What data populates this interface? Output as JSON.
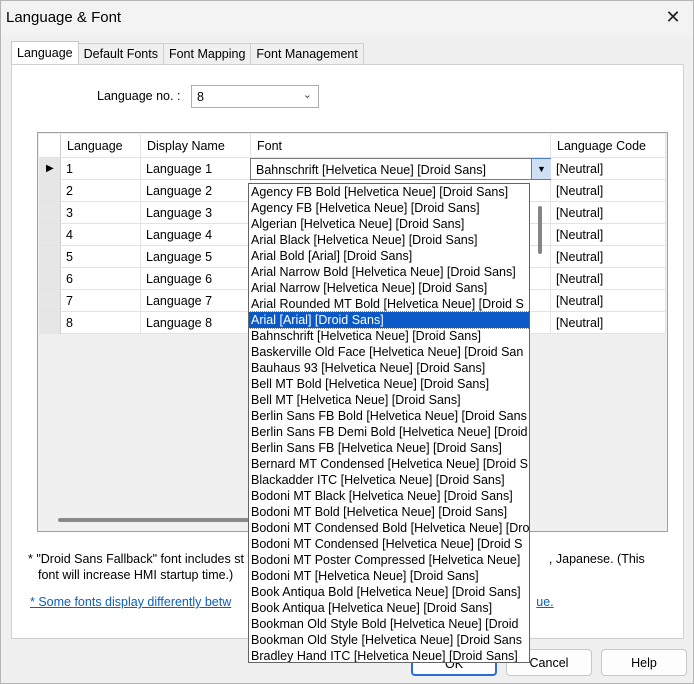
{
  "window": {
    "title": "Language & Font"
  },
  "tabs": [
    {
      "label": "Language"
    },
    {
      "label": "Default Fonts"
    },
    {
      "label": "Font Mapping"
    },
    {
      "label": "Font Management"
    }
  ],
  "language_no": {
    "label": "Language no. :",
    "value": "8"
  },
  "grid": {
    "headers": {
      "language": "Language",
      "display_name": "Display Name",
      "font": "Font",
      "language_code": "Language Code"
    },
    "rows": [
      {
        "language": "1",
        "display_name": "Language 1",
        "language_code": "[Neutral]"
      },
      {
        "language": "2",
        "display_name": "Language 2",
        "language_code": "[Neutral]"
      },
      {
        "language": "3",
        "display_name": "Language 3",
        "language_code": "[Neutral]"
      },
      {
        "language": "4",
        "display_name": "Language 4",
        "language_code": "[Neutral]"
      },
      {
        "language": "5",
        "display_name": "Language 5",
        "language_code": "[Neutral]"
      },
      {
        "language": "6",
        "display_name": "Language 6",
        "language_code": "[Neutral]"
      },
      {
        "language": "7",
        "display_name": "Language 7",
        "language_code": "[Neutral]"
      },
      {
        "language": "8",
        "display_name": "Language 8",
        "language_code": "[Neutral]"
      }
    ],
    "active_font": "Bahnschrift [Helvetica Neue] [Droid Sans]"
  },
  "font_dropdown": {
    "items": [
      "Agency FB Bold [Helvetica Neue] [Droid Sans]",
      "Agency FB [Helvetica Neue] [Droid Sans]",
      "Algerian [Helvetica Neue] [Droid Sans]",
      "Arial Black [Helvetica Neue] [Droid Sans]",
      "Arial Bold [Arial] [Droid Sans]",
      "Arial Narrow Bold [Helvetica Neue] [Droid Sans]",
      "Arial Narrow [Helvetica Neue] [Droid Sans]",
      "Arial Rounded MT Bold [Helvetica Neue] [Droid S",
      "Arial [Arial] [Droid Sans]",
      "Bahnschrift [Helvetica Neue] [Droid Sans]",
      "Baskerville Old Face [Helvetica Neue] [Droid San",
      "Bauhaus 93 [Helvetica Neue] [Droid Sans]",
      "Bell MT Bold [Helvetica Neue] [Droid Sans]",
      "Bell MT [Helvetica Neue] [Droid Sans]",
      "Berlin Sans FB Bold [Helvetica Neue] [Droid Sans",
      "Berlin Sans FB Demi Bold [Helvetica Neue] [Droid",
      "Berlin Sans FB [Helvetica Neue] [Droid Sans]",
      "Bernard MT Condensed [Helvetica Neue] [Droid S",
      "Blackadder ITC [Helvetica Neue] [Droid Sans]",
      "Bodoni MT Black [Helvetica Neue] [Droid Sans]",
      "Bodoni MT Bold [Helvetica Neue] [Droid Sans]",
      "Bodoni MT Condensed Bold [Helvetica Neue] [Dro",
      "Bodoni MT Condensed [Helvetica Neue] [Droid S",
      "Bodoni MT Poster Compressed [Helvetica Neue]",
      "Bodoni MT [Helvetica Neue] [Droid Sans]",
      "Book Antiqua Bold [Helvetica Neue] [Droid Sans]",
      "Book Antiqua [Helvetica Neue] [Droid Sans]",
      "Bookman Old Style Bold [Helvetica Neue] [Droid",
      "Bookman Old Style [Helvetica Neue] [Droid Sans",
      "Bradley Hand ITC [Helvetica Neue] [Droid Sans]"
    ],
    "selected_index": 8
  },
  "note": {
    "line1_start": "* \"Droid Sans Fallback\" font includes st",
    "line1_end": ", Japanese. (This",
    "line2": "font will increase HMI startup time.)"
  },
  "link": {
    "start": "* Some fonts display differently betw",
    "end": "ue."
  },
  "buttons": {
    "ok": "OK",
    "cancel": "Cancel",
    "help": "Help"
  }
}
